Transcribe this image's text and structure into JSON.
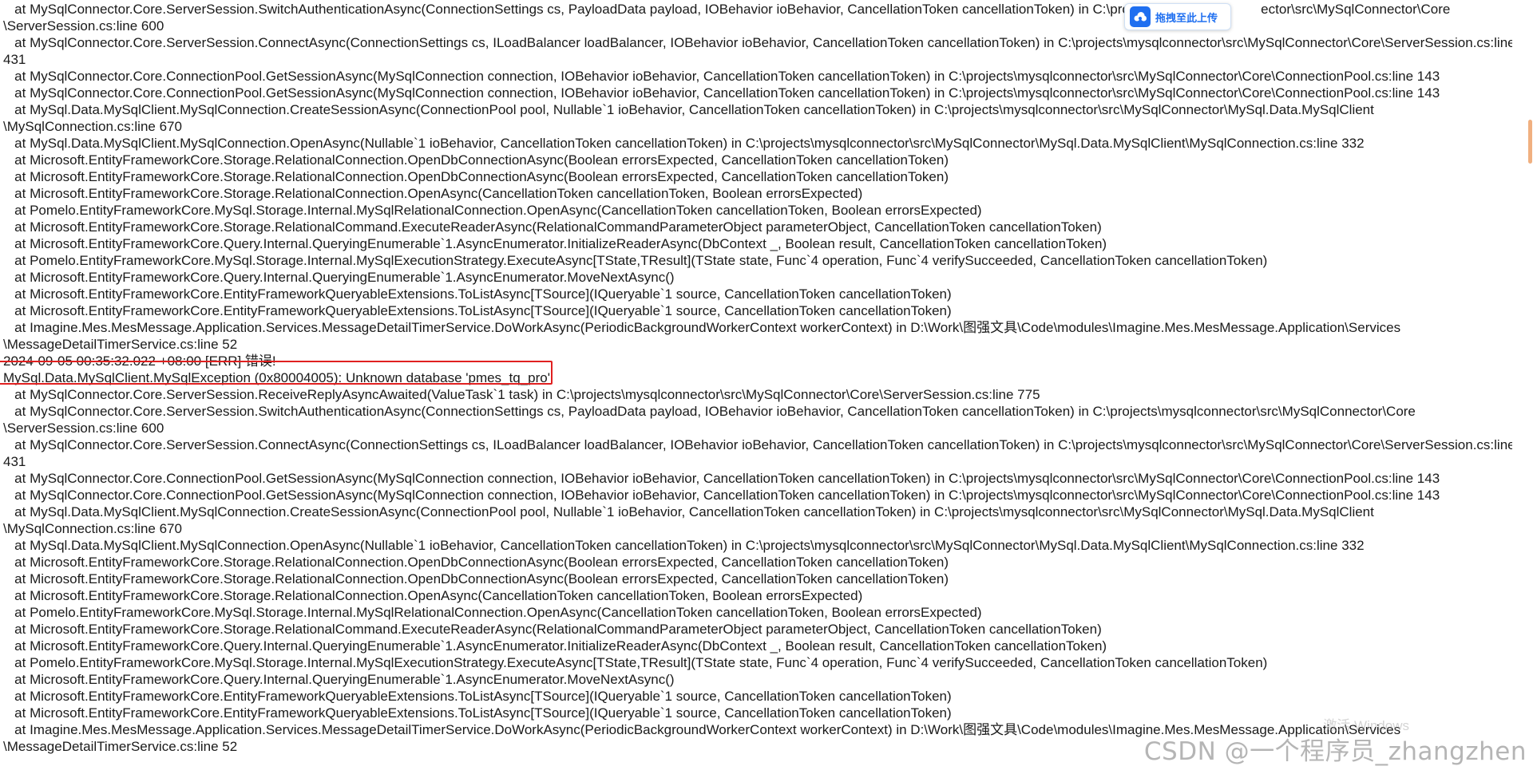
{
  "log": {
    "lines": [
      "   at MySqlConnector.Core.ServerSession.SwitchAuthenticationAsync(ConnectionSettings cs, PayloadData payload, IOBehavior ioBehavior, CancellationToken cancellationToken) in C:\\proj                                  ector\\src\\MySqlConnector\\Core",
      "\\ServerSession.cs:line 600",
      "   at MySqlConnector.Core.ServerSession.ConnectAsync(ConnectionSettings cs, ILoadBalancer loadBalancer, IOBehavior ioBehavior, CancellationToken cancellationToken) in C:\\projects\\mysqlconnector\\src\\MySqlConnector\\Core\\ServerSession.cs:line",
      "431",
      "   at MySqlConnector.Core.ConnectionPool.GetSessionAsync(MySqlConnection connection, IOBehavior ioBehavior, CancellationToken cancellationToken) in C:\\projects\\mysqlconnector\\src\\MySqlConnector\\Core\\ConnectionPool.cs:line 143",
      "   at MySqlConnector.Core.ConnectionPool.GetSessionAsync(MySqlConnection connection, IOBehavior ioBehavior, CancellationToken cancellationToken) in C:\\projects\\mysqlconnector\\src\\MySqlConnector\\Core\\ConnectionPool.cs:line 143",
      "   at MySql.Data.MySqlClient.MySqlConnection.CreateSessionAsync(ConnectionPool pool, Nullable`1 ioBehavior, CancellationToken cancellationToken) in C:\\projects\\mysqlconnector\\src\\MySqlConnector\\MySql.Data.MySqlClient",
      "\\MySqlConnection.cs:line 670",
      "   at MySql.Data.MySqlClient.MySqlConnection.OpenAsync(Nullable`1 ioBehavior, CancellationToken cancellationToken) in C:\\projects\\mysqlconnector\\src\\MySqlConnector\\MySql.Data.MySqlClient\\MySqlConnection.cs:line 332",
      "   at Microsoft.EntityFrameworkCore.Storage.RelationalConnection.OpenDbConnectionAsync(Boolean errorsExpected, CancellationToken cancellationToken)",
      "   at Microsoft.EntityFrameworkCore.Storage.RelationalConnection.OpenDbConnectionAsync(Boolean errorsExpected, CancellationToken cancellationToken)",
      "   at Microsoft.EntityFrameworkCore.Storage.RelationalConnection.OpenAsync(CancellationToken cancellationToken, Boolean errorsExpected)",
      "   at Pomelo.EntityFrameworkCore.MySql.Storage.Internal.MySqlRelationalConnection.OpenAsync(CancellationToken cancellationToken, Boolean errorsExpected)",
      "   at Microsoft.EntityFrameworkCore.Storage.RelationalCommand.ExecuteReaderAsync(RelationalCommandParameterObject parameterObject, CancellationToken cancellationToken)",
      "   at Microsoft.EntityFrameworkCore.Query.Internal.QueryingEnumerable`1.AsyncEnumerator.InitializeReaderAsync(DbContext _, Boolean result, CancellationToken cancellationToken)",
      "   at Pomelo.EntityFrameworkCore.MySql.Storage.Internal.MySqlExecutionStrategy.ExecuteAsync[TState,TResult](TState state, Func`4 operation, Func`4 verifySucceeded, CancellationToken cancellationToken)",
      "   at Microsoft.EntityFrameworkCore.Query.Internal.QueryingEnumerable`1.AsyncEnumerator.MoveNextAsync()",
      "   at Microsoft.EntityFrameworkCore.EntityFrameworkQueryableExtensions.ToListAsync[TSource](IQueryable`1 source, CancellationToken cancellationToken)",
      "   at Microsoft.EntityFrameworkCore.EntityFrameworkQueryableExtensions.ToListAsync[TSource](IQueryable`1 source, CancellationToken cancellationToken)",
      "   at Imagine.Mes.MesMessage.Application.Services.MessageDetailTimerService.DoWorkAsync(PeriodicBackgroundWorkerContext workerContext) in D:\\Work\\图强文具\\Code\\modules\\Imagine.Mes.MesMessage.Application\\Services",
      "\\MessageDetailTimerService.cs:line 52",
      "2024-09-05 00:35:32.022 +08:00 [ERR] 错误!",
      "MySql.Data.MySqlClient.MySqlException (0x80004005): Unknown database 'pmes_tq_pro'",
      "   at MySqlConnector.Core.ServerSession.ReceiveReplyAsyncAwaited(ValueTask`1 task) in C:\\projects\\mysqlconnector\\src\\MySqlConnector\\Core\\ServerSession.cs:line 775",
      "   at MySqlConnector.Core.ServerSession.SwitchAuthenticationAsync(ConnectionSettings cs, PayloadData payload, IOBehavior ioBehavior, CancellationToken cancellationToken) in C:\\projects\\mysqlconnector\\src\\MySqlConnector\\Core",
      "\\ServerSession.cs:line 600",
      "   at MySqlConnector.Core.ServerSession.ConnectAsync(ConnectionSettings cs, ILoadBalancer loadBalancer, IOBehavior ioBehavior, CancellationToken cancellationToken) in C:\\projects\\mysqlconnector\\src\\MySqlConnector\\Core\\ServerSession.cs:line",
      "431",
      "   at MySqlConnector.Core.ConnectionPool.GetSessionAsync(MySqlConnection connection, IOBehavior ioBehavior, CancellationToken cancellationToken) in C:\\projects\\mysqlconnector\\src\\MySqlConnector\\Core\\ConnectionPool.cs:line 143",
      "   at MySqlConnector.Core.ConnectionPool.GetSessionAsync(MySqlConnection connection, IOBehavior ioBehavior, CancellationToken cancellationToken) in C:\\projects\\mysqlconnector\\src\\MySqlConnector\\Core\\ConnectionPool.cs:line 143",
      "   at MySql.Data.MySqlClient.MySqlConnection.CreateSessionAsync(ConnectionPool pool, Nullable`1 ioBehavior, CancellationToken cancellationToken) in C:\\projects\\mysqlconnector\\src\\MySqlConnector\\MySql.Data.MySqlClient",
      "\\MySqlConnection.cs:line 670",
      "   at MySql.Data.MySqlClient.MySqlConnection.OpenAsync(Nullable`1 ioBehavior, CancellationToken cancellationToken) in C:\\projects\\mysqlconnector\\src\\MySqlConnector\\MySql.Data.MySqlClient\\MySqlConnection.cs:line 332",
      "   at Microsoft.EntityFrameworkCore.Storage.RelationalConnection.OpenDbConnectionAsync(Boolean errorsExpected, CancellationToken cancellationToken)",
      "   at Microsoft.EntityFrameworkCore.Storage.RelationalConnection.OpenDbConnectionAsync(Boolean errorsExpected, CancellationToken cancellationToken)",
      "   at Microsoft.EntityFrameworkCore.Storage.RelationalConnection.OpenAsync(CancellationToken cancellationToken, Boolean errorsExpected)",
      "   at Pomelo.EntityFrameworkCore.MySql.Storage.Internal.MySqlRelationalConnection.OpenAsync(CancellationToken cancellationToken, Boolean errorsExpected)",
      "   at Microsoft.EntityFrameworkCore.Storage.RelationalCommand.ExecuteReaderAsync(RelationalCommandParameterObject parameterObject, CancellationToken cancellationToken)",
      "   at Microsoft.EntityFrameworkCore.Query.Internal.QueryingEnumerable`1.AsyncEnumerator.InitializeReaderAsync(DbContext _, Boolean result, CancellationToken cancellationToken)",
      "   at Pomelo.EntityFrameworkCore.MySql.Storage.Internal.MySqlExecutionStrategy.ExecuteAsync[TState,TResult](TState state, Func`4 operation, Func`4 verifySucceeded, CancellationToken cancellationToken)",
      "   at Microsoft.EntityFrameworkCore.Query.Internal.QueryingEnumerable`1.AsyncEnumerator.MoveNextAsync()",
      "   at Microsoft.EntityFrameworkCore.EntityFrameworkQueryableExtensions.ToListAsync[TSource](IQueryable`1 source, CancellationToken cancellationToken)",
      "   at Microsoft.EntityFrameworkCore.EntityFrameworkQueryableExtensions.ToListAsync[TSource](IQueryable`1 source, CancellationToken cancellationToken)",
      "   at Imagine.Mes.MesMessage.Application.Services.MessageDetailTimerService.DoWorkAsync(PeriodicBackgroundWorkerContext workerContext) in D:\\Work\\图强文具\\Code\\modules\\Imagine.Mes.MesMessage.Application\\Services",
      "\\MessageDetailTimerService.cs:line 52"
    ],
    "highlighted_line_index": 22
  },
  "upload_widget": {
    "label": "拖拽至此上传",
    "icon": "cloud-upload-icon",
    "accent_color": "#1f6ff0"
  },
  "watermark": {
    "text": "CSDN @一个程序员_zhangzhen",
    "activation_text": "激活 Windows"
  },
  "colors": {
    "highlight_border": "#e02020",
    "scroll_thumb": "#f0b080"
  }
}
